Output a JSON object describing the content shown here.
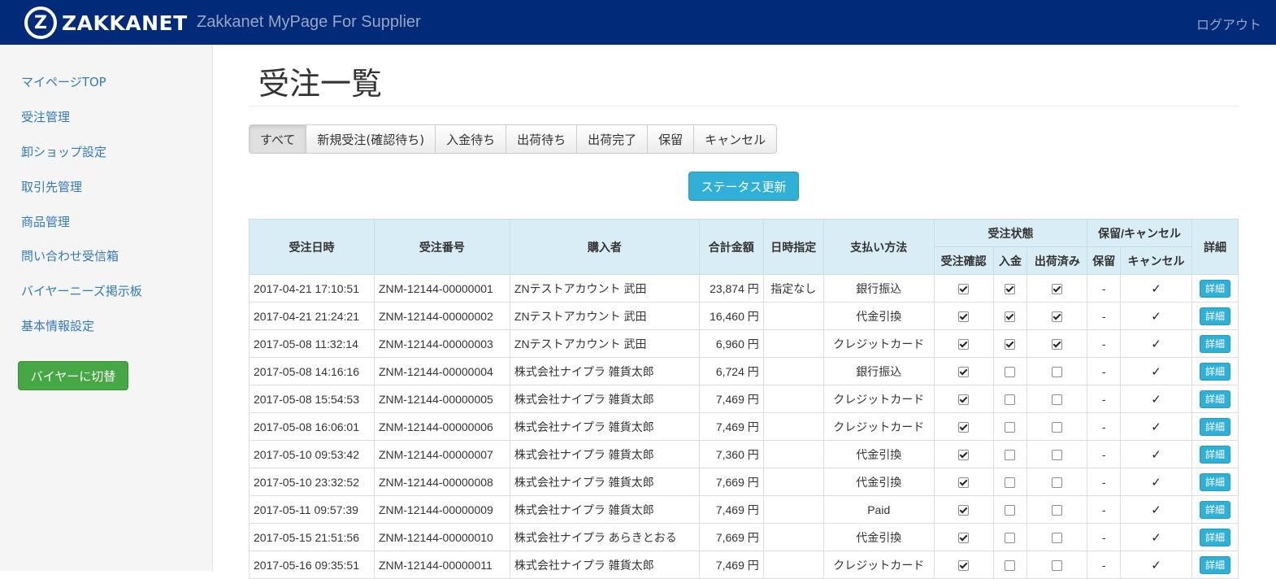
{
  "header": {
    "logo_mark": "Z",
    "logo_text": "ZAKKANET",
    "app_title": "Zakkanet MyPage For Supplier",
    "logout_label": "ログアウト",
    "bg_color": "#012a78"
  },
  "sidebar": {
    "items": [
      {
        "label": "マイページTOP"
      },
      {
        "label": "受注管理"
      },
      {
        "label": "卸ショップ設定"
      },
      {
        "label": "取引先管理"
      },
      {
        "label": "商品管理"
      },
      {
        "label": "問い合わせ受信箱"
      },
      {
        "label": "バイヤーニーズ掲示板"
      },
      {
        "label": "基本情報設定"
      }
    ],
    "switch_button": "バイヤーに切替"
  },
  "main": {
    "title": "受注一覧",
    "tabs": [
      "すべて",
      "新規受注(確認待ち)",
      "入金待ち",
      "出荷待ち",
      "出荷完了",
      "保留",
      "キャンセル"
    ],
    "active_tab": "すべて",
    "status_update_button": "ステータス更新"
  },
  "table": {
    "headers": {
      "date": "受注日時",
      "order_no": "受注番号",
      "buyer": "購入者",
      "total": "合計金額",
      "delivery_time": "日時指定",
      "payment": "支払い方法",
      "order_status": "受注状態",
      "confirm": "受注確認",
      "paid": "入金",
      "shipped": "出荷済み",
      "hold_cancel": "保留/キャンセル",
      "hold": "保留",
      "cancel": "キャンセル",
      "detail": "詳細"
    },
    "rows": [
      {
        "date": "2017-04-21 17:10:51",
        "order_no": "ZNM-12144-00000001",
        "buyer": "ZNテストアカウント 武田",
        "total": "23,874 円",
        "delivery_time": "指定なし",
        "payment": "銀行振込",
        "confirm": true,
        "paid": true,
        "shipped": true,
        "hold": "-",
        "cancel": "✓",
        "detail": "詳細"
      },
      {
        "date": "2017-04-21 21:24:21",
        "order_no": "ZNM-12144-00000002",
        "buyer": "ZNテストアカウント 武田",
        "total": "16,460 円",
        "delivery_time": "",
        "payment": "代金引換",
        "confirm": true,
        "paid": true,
        "shipped": true,
        "hold": "-",
        "cancel": "✓",
        "detail": "詳細"
      },
      {
        "date": "2017-05-08 11:32:14",
        "order_no": "ZNM-12144-00000003",
        "buyer": "ZNテストアカウント 武田",
        "total": "6,960 円",
        "delivery_time": "",
        "payment": "クレジットカード",
        "confirm": true,
        "paid": true,
        "shipped": true,
        "hold": "-",
        "cancel": "✓",
        "detail": "詳細"
      },
      {
        "date": "2017-05-08 14:16:16",
        "order_no": "ZNM-12144-00000004",
        "buyer": "株式会社ナイプラ 雑貨太郎",
        "total": "6,724 円",
        "delivery_time": "",
        "payment": "銀行振込",
        "confirm": true,
        "paid": false,
        "shipped": false,
        "hold": "-",
        "cancel": "✓",
        "detail": "詳細"
      },
      {
        "date": "2017-05-08 15:54:53",
        "order_no": "ZNM-12144-00000005",
        "buyer": "株式会社ナイプラ 雑貨太郎",
        "total": "7,469 円",
        "delivery_time": "",
        "payment": "クレジットカード",
        "confirm": true,
        "paid": false,
        "shipped": false,
        "hold": "-",
        "cancel": "✓",
        "detail": "詳細"
      },
      {
        "date": "2017-05-08 16:06:01",
        "order_no": "ZNM-12144-00000006",
        "buyer": "株式会社ナイプラ 雑貨太郎",
        "total": "7,469 円",
        "delivery_time": "",
        "payment": "クレジットカード",
        "confirm": true,
        "paid": false,
        "shipped": false,
        "hold": "-",
        "cancel": "✓",
        "detail": "詳細"
      },
      {
        "date": "2017-05-10 09:53:42",
        "order_no": "ZNM-12144-00000007",
        "buyer": "株式会社ナイプラ 雑貨太郎",
        "total": "7,360 円",
        "delivery_time": "",
        "payment": "代金引換",
        "confirm": true,
        "paid": false,
        "shipped": false,
        "hold": "-",
        "cancel": "✓",
        "detail": "詳細"
      },
      {
        "date": "2017-05-10 23:32:52",
        "order_no": "ZNM-12144-00000008",
        "buyer": "株式会社ナイプラ 雑貨太郎",
        "total": "7,669 円",
        "delivery_time": "",
        "payment": "代金引換",
        "confirm": true,
        "paid": false,
        "shipped": false,
        "hold": "-",
        "cancel": "✓",
        "detail": "詳細"
      },
      {
        "date": "2017-05-11 09:57:39",
        "order_no": "ZNM-12144-00000009",
        "buyer": "株式会社ナイプラ 雑貨太郎",
        "total": "7,469 円",
        "delivery_time": "",
        "payment": "Paid",
        "confirm": true,
        "paid": false,
        "shipped": false,
        "hold": "-",
        "cancel": "✓",
        "detail": "詳細"
      },
      {
        "date": "2017-05-15 21:51:56",
        "order_no": "ZNM-12144-00000010",
        "buyer": "株式会社ナイプラ あらきとおる",
        "total": "7,669 円",
        "delivery_time": "",
        "payment": "代金引換",
        "confirm": true,
        "paid": false,
        "shipped": false,
        "hold": "-",
        "cancel": "✓",
        "detail": "詳細"
      },
      {
        "date": "2017-05-16 09:35:51",
        "order_no": "ZNM-12144-00000011",
        "buyer": "株式会社ナイプラ 雑貨太郎",
        "total": "7,469 円",
        "delivery_time": "",
        "payment": "クレジットカード",
        "confirm": true,
        "paid": false,
        "shipped": false,
        "hold": "-",
        "cancel": "✓",
        "detail": "詳細"
      }
    ]
  }
}
